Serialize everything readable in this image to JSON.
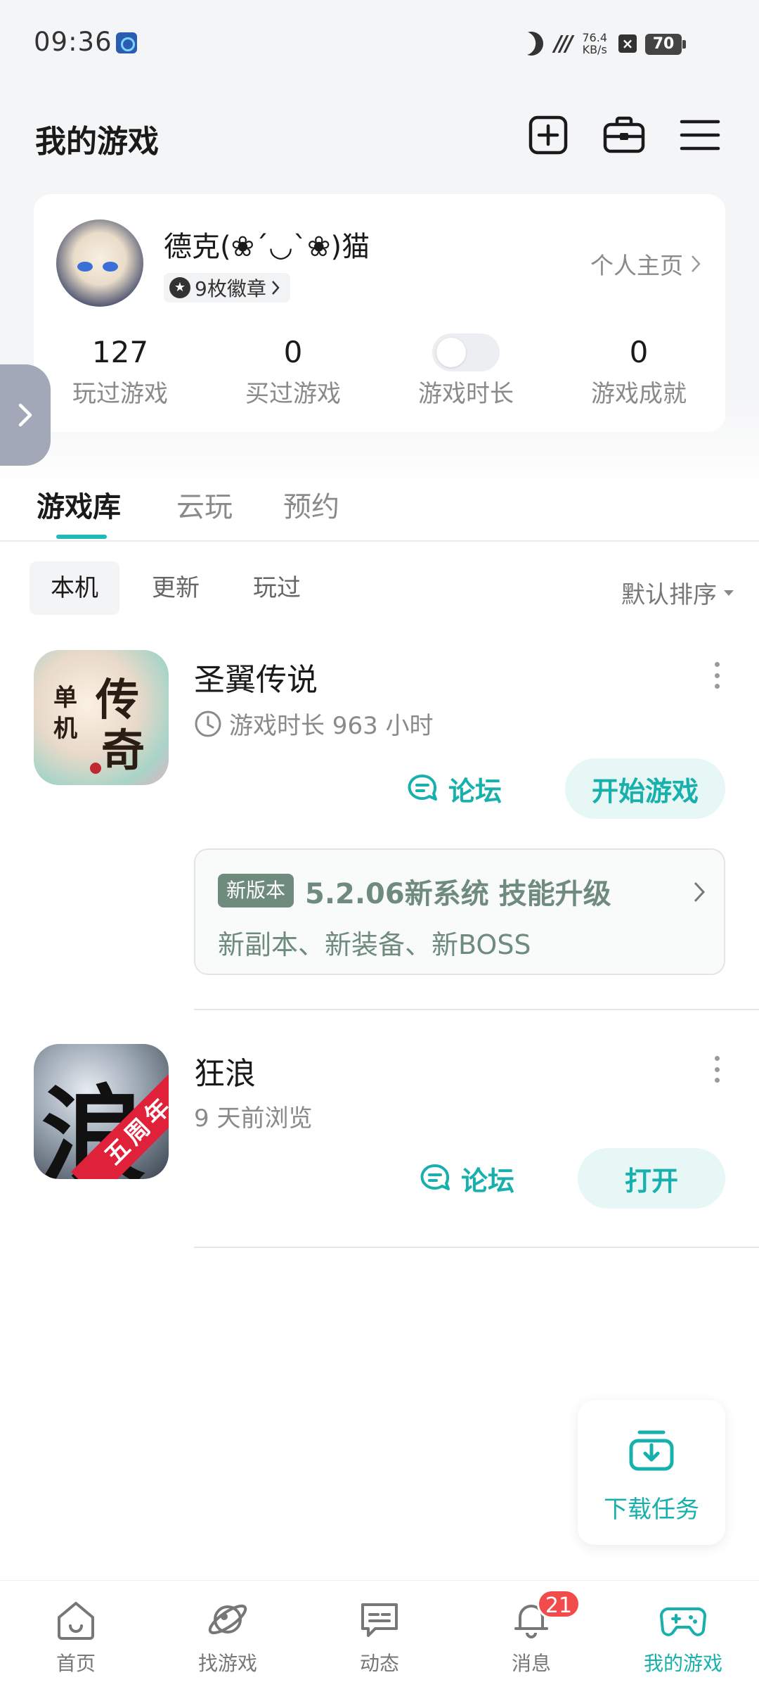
{
  "status_bar": {
    "time": "09:36",
    "net_speed_value": "76.4",
    "net_speed_unit": "KB/s",
    "battery": "70"
  },
  "header": {
    "title": "我的游戏"
  },
  "profile": {
    "username": "德克(❀´◡`❀)猫",
    "badges": "9枚徽章",
    "home_link": "个人主页",
    "stats": [
      {
        "value": "127",
        "label": "玩过游戏"
      },
      {
        "value": "0",
        "label": "买过游戏"
      },
      {
        "value": "",
        "label": "游戏时长"
      },
      {
        "value": "0",
        "label": "游戏成就"
      }
    ]
  },
  "main_tabs": [
    "游戏库",
    "云玩",
    "预约"
  ],
  "sub_tabs": [
    "本机",
    "更新",
    "玩过"
  ],
  "sort_label": "默认排序",
  "games": [
    {
      "name": "圣翼传说",
      "subtitle": "游戏时长 963 小时",
      "forum_label": "论坛",
      "action_label": "开始游戏",
      "update": {
        "tag": "新版本",
        "title": "5.2.06新系统 技能升级",
        "desc": "新副本、新装备、新BOSS"
      },
      "icon_text": [
        "单",
        "机",
        "传",
        "奇"
      ]
    },
    {
      "name": "狂浪",
      "subtitle": "9 天前浏览",
      "forum_label": "论坛",
      "action_label": "打开",
      "icon_text": [
        "浪",
        "五周年"
      ]
    }
  ],
  "download_task": "下载任务",
  "bottom_nav": [
    {
      "label": "首页",
      "icon": "home-icon"
    },
    {
      "label": "找游戏",
      "icon": "planet-icon"
    },
    {
      "label": "动态",
      "icon": "chat-icon"
    },
    {
      "label": "消息",
      "icon": "bell-icon",
      "badge": "21"
    },
    {
      "label": "我的游戏",
      "icon": "gamepad-icon"
    }
  ],
  "accent_color": "#18b0ad"
}
